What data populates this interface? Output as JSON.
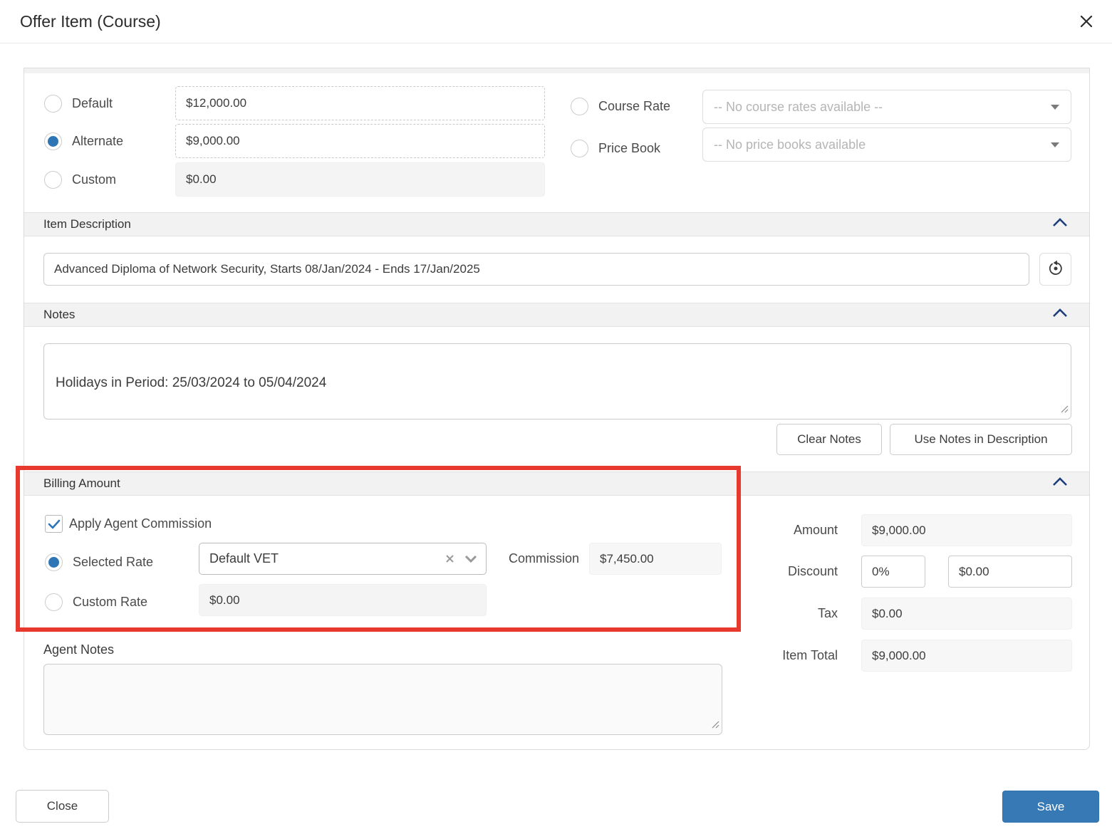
{
  "modal": {
    "title": "Offer Item (Course)"
  },
  "pricing": {
    "default": {
      "label": "Default",
      "value": "$12,000.00",
      "selected": false
    },
    "alternate": {
      "label": "Alternate",
      "value": "$9,000.00",
      "selected": true
    },
    "custom": {
      "label": "Custom",
      "value": "$0.00",
      "selected": false
    },
    "course_rate": {
      "label": "Course Rate",
      "selected": false,
      "placeholder": "-- No course rates available --"
    },
    "price_book": {
      "label": "Price Book",
      "selected": false,
      "placeholder": "-- No price books available"
    }
  },
  "item_description": {
    "header": "Item Description",
    "value": "Advanced Diploma of Network Security, Starts 08/Jan/2024 - Ends 17/Jan/2025"
  },
  "notes": {
    "header": "Notes",
    "value": "Holidays in Period: 25/03/2024 to 05/04/2024",
    "clear_button": "Clear Notes",
    "use_button": "Use Notes in Description"
  },
  "billing": {
    "header": "Billing Amount",
    "apply_commission": {
      "label": "Apply Agent Commission",
      "checked": true
    },
    "selected_rate": {
      "label": "Selected Rate",
      "selected": true,
      "value": "Default VET"
    },
    "commission": {
      "label": "Commission",
      "value": "$7,450.00"
    },
    "custom_rate": {
      "label": "Custom Rate",
      "selected": false,
      "value": "$0.00"
    },
    "agent_notes": {
      "label": "Agent Notes",
      "value": ""
    }
  },
  "totals": {
    "amount": {
      "label": "Amount",
      "value": "$9,000.00"
    },
    "discount": {
      "label": "Discount",
      "percent": "0%",
      "amount": "$0.00"
    },
    "tax": {
      "label": "Tax",
      "value": "$0.00"
    },
    "item_total": {
      "label": "Item Total",
      "value": "$9,000.00"
    }
  },
  "footer": {
    "close_label": "Close",
    "save_label": "Save"
  },
  "colors": {
    "accent_blue": "#2e75b6",
    "save_blue": "#3679b5",
    "chevron_navy": "#1d3d7c",
    "annotation_red": "#e8392e",
    "section_header_gray": "#f2f2f2"
  }
}
